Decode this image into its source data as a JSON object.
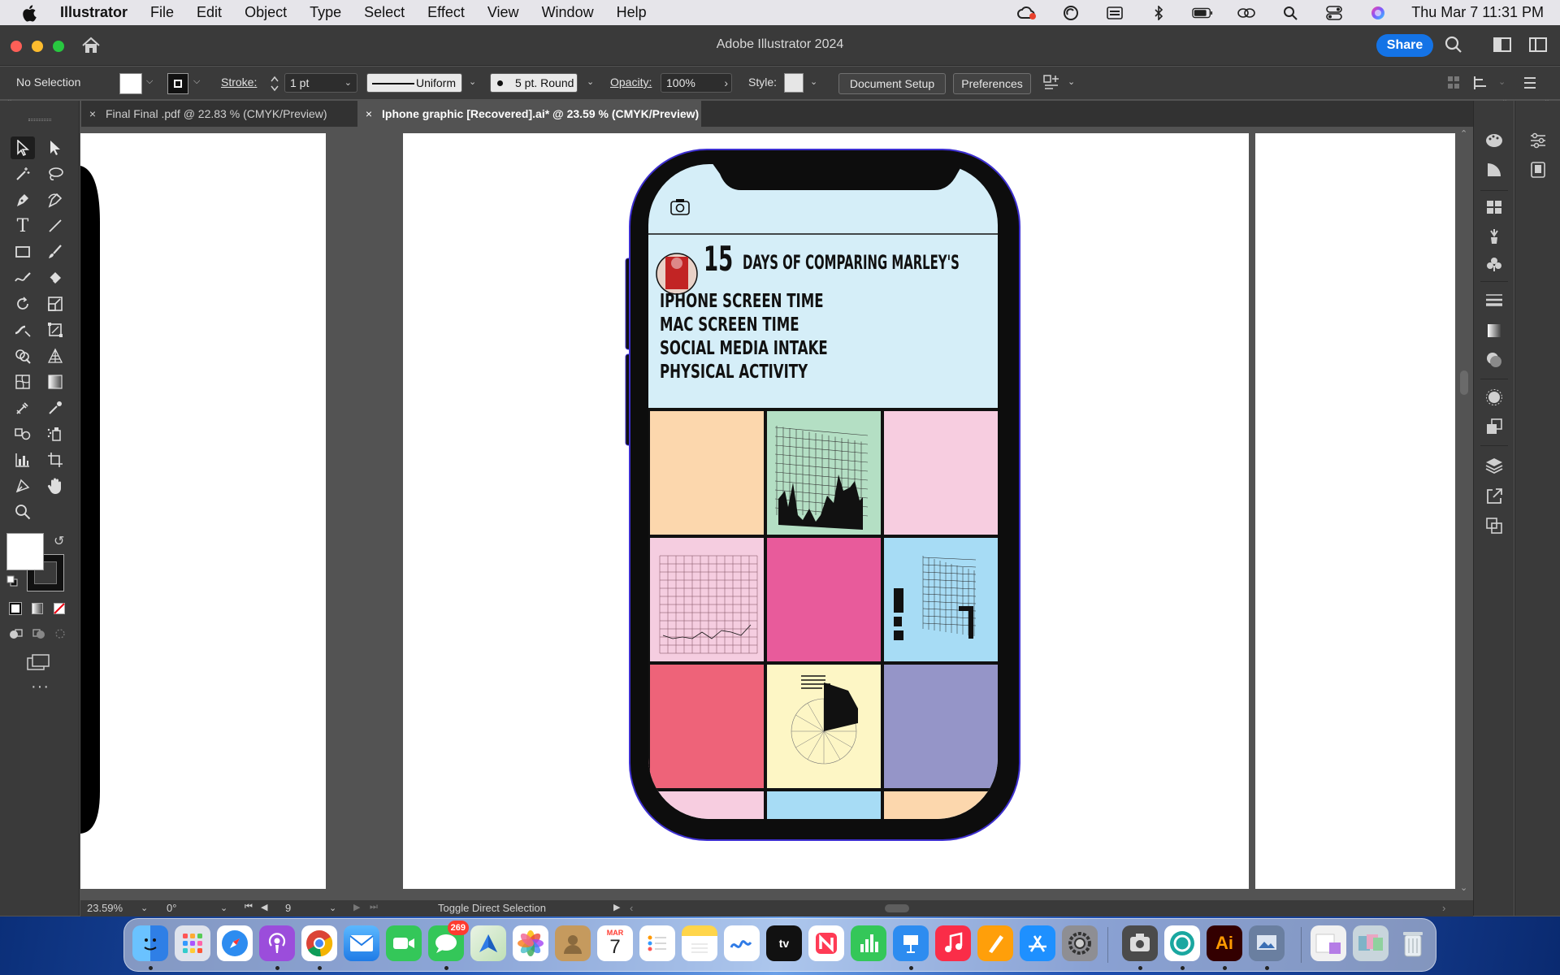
{
  "menubar": {
    "app": "Illustrator",
    "items": [
      "File",
      "Edit",
      "Object",
      "Type",
      "Select",
      "Effect",
      "View",
      "Window",
      "Help"
    ],
    "clock": "Thu Mar 7  11:31 PM"
  },
  "window": {
    "title": "Adobe Illustrator 2024",
    "share_label": "Share"
  },
  "control": {
    "selection": "No Selection",
    "stroke_label": "Stroke:",
    "stroke_value": "1 pt",
    "profile": "Uniform",
    "brush": "5 pt. Round",
    "opacity_label": "Opacity:",
    "opacity_value": "100%",
    "style_label": "Style:",
    "document_setup": "Document Setup",
    "preferences": "Preferences"
  },
  "tabs": [
    {
      "label": "Final Final .pdf @ 22.83 % (CMYK/Preview)"
    },
    {
      "label": "Iphone graphic [Recovered].ai* @ 23.59 % (CMYK/Preview)"
    }
  ],
  "artwork": {
    "headline_num": "15",
    "headline": "DAYS OF COMPARING MARLEY'S",
    "lines": [
      "IPHONE SCREEN TIME",
      "MAC SCREEN TIME",
      "SOCIAL MEDIA INTAKE",
      "PHYSICAL ACTIVITY"
    ],
    "tiles": {
      "r1": [
        "#fcd7ad",
        "#b4dfc4",
        "#f7cde0"
      ],
      "r2": [
        "#f5cde0",
        "#e85b9b",
        "#a7dcf5"
      ],
      "r3": [
        "#ee6379",
        "#fdf6c5",
        "#9595c8"
      ],
      "r4": [
        "#f7cde0",
        "#a7dcf5",
        "#fcd7ad"
      ]
    },
    "screen_color": "#d5eef8"
  },
  "status": {
    "zoom": "23.59%",
    "rotation": "0°",
    "artboard": "9",
    "hint": "Toggle Direct Selection"
  },
  "dock": {
    "messages_badge": "269",
    "calendar_month": "MAR",
    "calendar_day": "7",
    "illustrator_label": "Ai"
  }
}
